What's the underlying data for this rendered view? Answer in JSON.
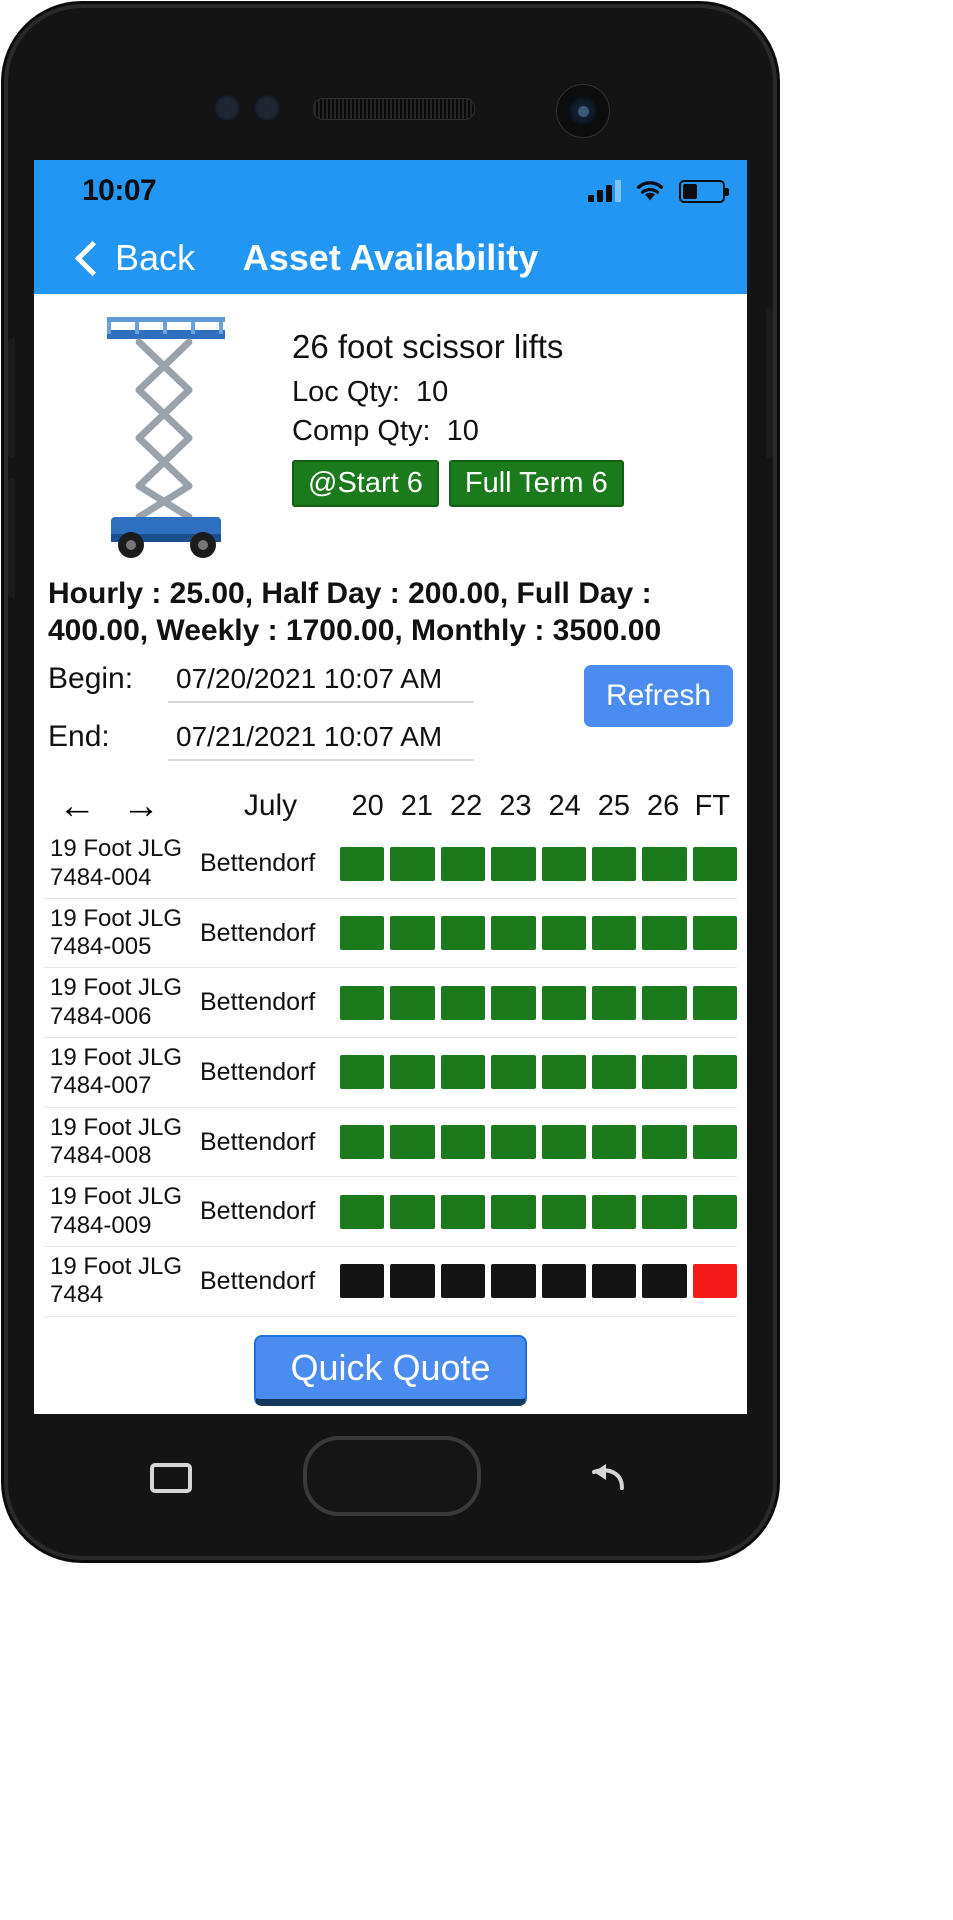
{
  "statusbar": {
    "time": "10:07",
    "signal_icon": "signal-bars-icon",
    "wifi_icon": "wifi-icon",
    "battery_icon": "battery-icon",
    "battery_level_pct": 34
  },
  "navbar": {
    "back_label": "Back",
    "back_icon": "chevron-left-icon",
    "title": "Asset Availability",
    "bg_color": "#2196f3"
  },
  "asset": {
    "image_icon": "scissor-lift-image",
    "title": "26 foot scissor lifts",
    "loc_qty_label": "Loc Qty:",
    "loc_qty_value": "10",
    "comp_qty_label": "Comp Qty:",
    "comp_qty_value": "10",
    "badges": [
      {
        "label": "@Start 6",
        "color": "#1b7a1b"
      },
      {
        "label": "Full Term 6",
        "color": "#1b7a1b"
      }
    ]
  },
  "rates": {
    "text": "Hourly : 25.00, Half Day : 200.00, Full Day : 400.00, Weekly : 1700.00, Monthly : 3500.00"
  },
  "dates": {
    "begin_label": "Begin:",
    "begin_value": "07/20/2021 10:07 AM",
    "end_label": "End:",
    "end_value": "07/21/2021 10:07 AM",
    "refresh_label": "Refresh"
  },
  "calendar": {
    "prev_icon": "arrow-left-icon",
    "next_icon": "arrow-right-icon",
    "prev_label": "←",
    "next_label": "→",
    "month": "July",
    "columns": [
      "20",
      "21",
      "22",
      "23",
      "24",
      "25",
      "26",
      "FT"
    ]
  },
  "table": {
    "rows": [
      {
        "name": "19 Foot JLG 7484-004",
        "location": "Bettendorf",
        "cells": [
          "green",
          "green",
          "green",
          "green",
          "green",
          "green",
          "green",
          "green"
        ]
      },
      {
        "name": "19 Foot JLG 7484-005",
        "location": "Bettendorf",
        "cells": [
          "green",
          "green",
          "green",
          "green",
          "green",
          "green",
          "green",
          "green"
        ]
      },
      {
        "name": "19 Foot JLG 7484-006",
        "location": "Bettendorf",
        "cells": [
          "green",
          "green",
          "green",
          "green",
          "green",
          "green",
          "green",
          "green"
        ]
      },
      {
        "name": "19 Foot JLG 7484-007",
        "location": "Bettendorf",
        "cells": [
          "green",
          "green",
          "green",
          "green",
          "green",
          "green",
          "green",
          "green"
        ]
      },
      {
        "name": "19 Foot JLG 7484-008",
        "location": "Bettendorf",
        "cells": [
          "green",
          "green",
          "green",
          "green",
          "green",
          "green",
          "green",
          "green"
        ]
      },
      {
        "name": "19 Foot JLG 7484-009",
        "location": "Bettendorf",
        "cells": [
          "green",
          "green",
          "green",
          "green",
          "green",
          "green",
          "green",
          "green"
        ]
      },
      {
        "name": "19 Foot JLG 7484",
        "location": "Bettendorf",
        "cells": [
          "black",
          "black",
          "black",
          "black",
          "black",
          "black",
          "black",
          "red"
        ]
      }
    ],
    "cell_colors": {
      "green": "#1b7a1b",
      "black": "#141414",
      "red": "#f31a1a"
    }
  },
  "footer": {
    "quick_quote_label": "Quick Quote"
  }
}
